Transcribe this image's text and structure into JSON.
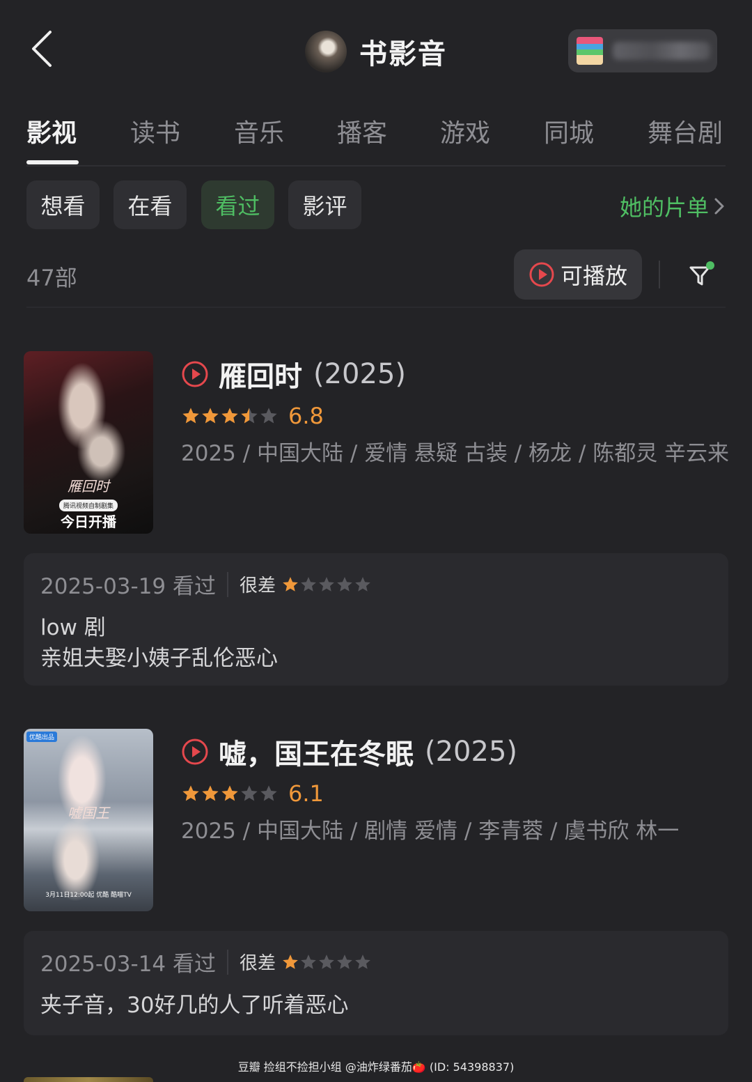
{
  "header": {
    "title": "书影音",
    "back_icon": "chevron-left-icon",
    "card_icon": "card-stack-icon"
  },
  "tabs": [
    {
      "label": "影视",
      "active": true
    },
    {
      "label": "读书",
      "active": false
    },
    {
      "label": "音乐",
      "active": false
    },
    {
      "label": "播客",
      "active": false
    },
    {
      "label": "游戏",
      "active": false
    },
    {
      "label": "同城",
      "active": false
    },
    {
      "label": "舞台剧",
      "active": false
    }
  ],
  "subtabs": [
    {
      "label": "想看",
      "active": false
    },
    {
      "label": "在看",
      "active": false
    },
    {
      "label": "看过",
      "active": true
    },
    {
      "label": "影评",
      "active": false
    }
  ],
  "her_list_label": "她的片单",
  "count_label": "47部",
  "playable_label": "可播放",
  "colors": {
    "background": "#232326",
    "accent_green": "#4fbe63",
    "star_orange": "#f0983a",
    "play_red": "#e5484d"
  },
  "items": [
    {
      "title": "雁回时",
      "year": "(2025)",
      "rating_stars": 3.5,
      "score": "6.8",
      "meta": "2025 / 中国大陆 / 爱情 悬疑 古装 / 杨龙 / 陈都灵 辛云来",
      "poster_text": "今日开播",
      "poster_tag": "腾讯视频自制剧集",
      "comment": {
        "date": "2025-03-19 看过",
        "rating_label": "很差",
        "rating_stars": 1,
        "text": "low 剧\n亲姐夫娶小姨子乱伦恶心"
      }
    },
    {
      "title": "嘘，国王在冬眠",
      "year": "(2025)",
      "rating_stars": 3,
      "score": "6.1",
      "meta": "2025 / 中国大陆 / 剧情 爱情 / 李青蓉 / 虞书欣 林一",
      "poster_badge": "优酷出品",
      "poster_line": "3月11日12:00起 优酷 酷喵TV",
      "comment": {
        "date": "2025-03-14 看过",
        "rating_label": "很差",
        "rating_stars": 1,
        "text": "夹子音，30好几的人了听着恶心"
      }
    }
  ],
  "watermark": "豆瓣  捡组不捡担小组 @油炸绿番茄🍅 (ID: 54398837)"
}
